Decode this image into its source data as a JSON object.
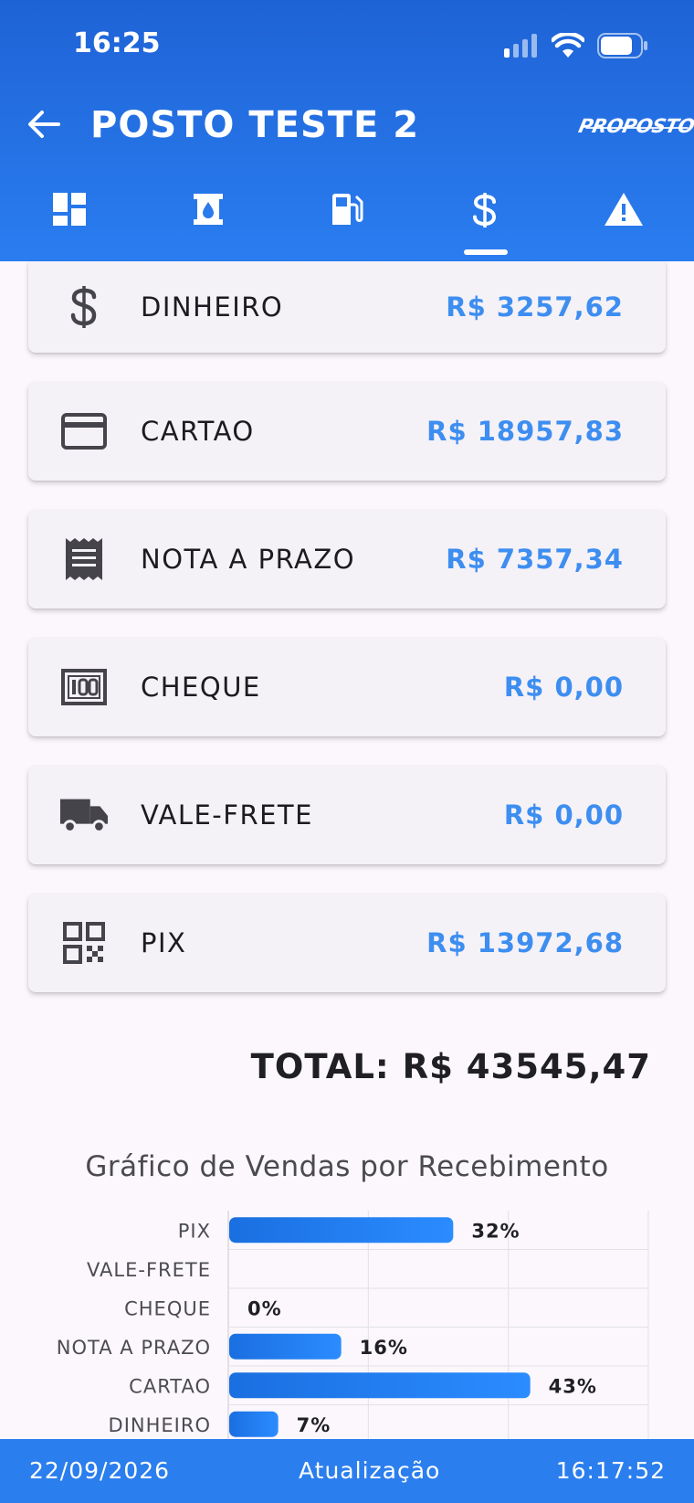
{
  "status_bar": {
    "time": "16:25"
  },
  "header": {
    "title": "POSTO TESTE 2",
    "brand": "PROPOSTO",
    "tabs": [
      {
        "icon": "dashboard-icon"
      },
      {
        "icon": "oil-tank-icon"
      },
      {
        "icon": "fuel-pump-icon"
      },
      {
        "icon": "dollar-icon",
        "selected": true
      },
      {
        "icon": "warning-icon"
      }
    ]
  },
  "payments": [
    {
      "icon": "dollar-icon",
      "label": "DINHEIRO",
      "value": "R$ 3257,62"
    },
    {
      "icon": "credit-card-icon",
      "label": "CARTAO",
      "value": "R$ 18957,83"
    },
    {
      "icon": "receipt-icon",
      "label": "NOTA A PRAZO",
      "value": "R$ 7357,34"
    },
    {
      "icon": "cheque-icon",
      "label": "CHEQUE",
      "value": "R$ 0,00"
    },
    {
      "icon": "truck-icon",
      "label": "VALE-FRETE",
      "value": "R$ 0,00"
    },
    {
      "icon": "qr-code-icon",
      "label": "PIX",
      "value": "R$ 13972,68"
    }
  ],
  "total": "TOTAL: R$ 43545,47",
  "chart_title": "Gráfico de Vendas por Recebimento",
  "chart_data": {
    "type": "bar",
    "orientation": "horizontal",
    "categories": [
      "PIX",
      "VALE-FRETE",
      "CHEQUE",
      "NOTA A PRAZO",
      "CARTAO",
      "DINHEIRO"
    ],
    "values": [
      32,
      0,
      0,
      16,
      43,
      7
    ],
    "data_labels": [
      "32%",
      "",
      "0%",
      "16%",
      "43%",
      "7%"
    ],
    "xlim": [
      0,
      60
    ],
    "grid": true,
    "colors": [
      "#1a6fe0",
      "#2b8cff"
    ]
  },
  "footer": {
    "date": "22/09/2026",
    "label": "Atualização",
    "time": "16:17:52"
  }
}
